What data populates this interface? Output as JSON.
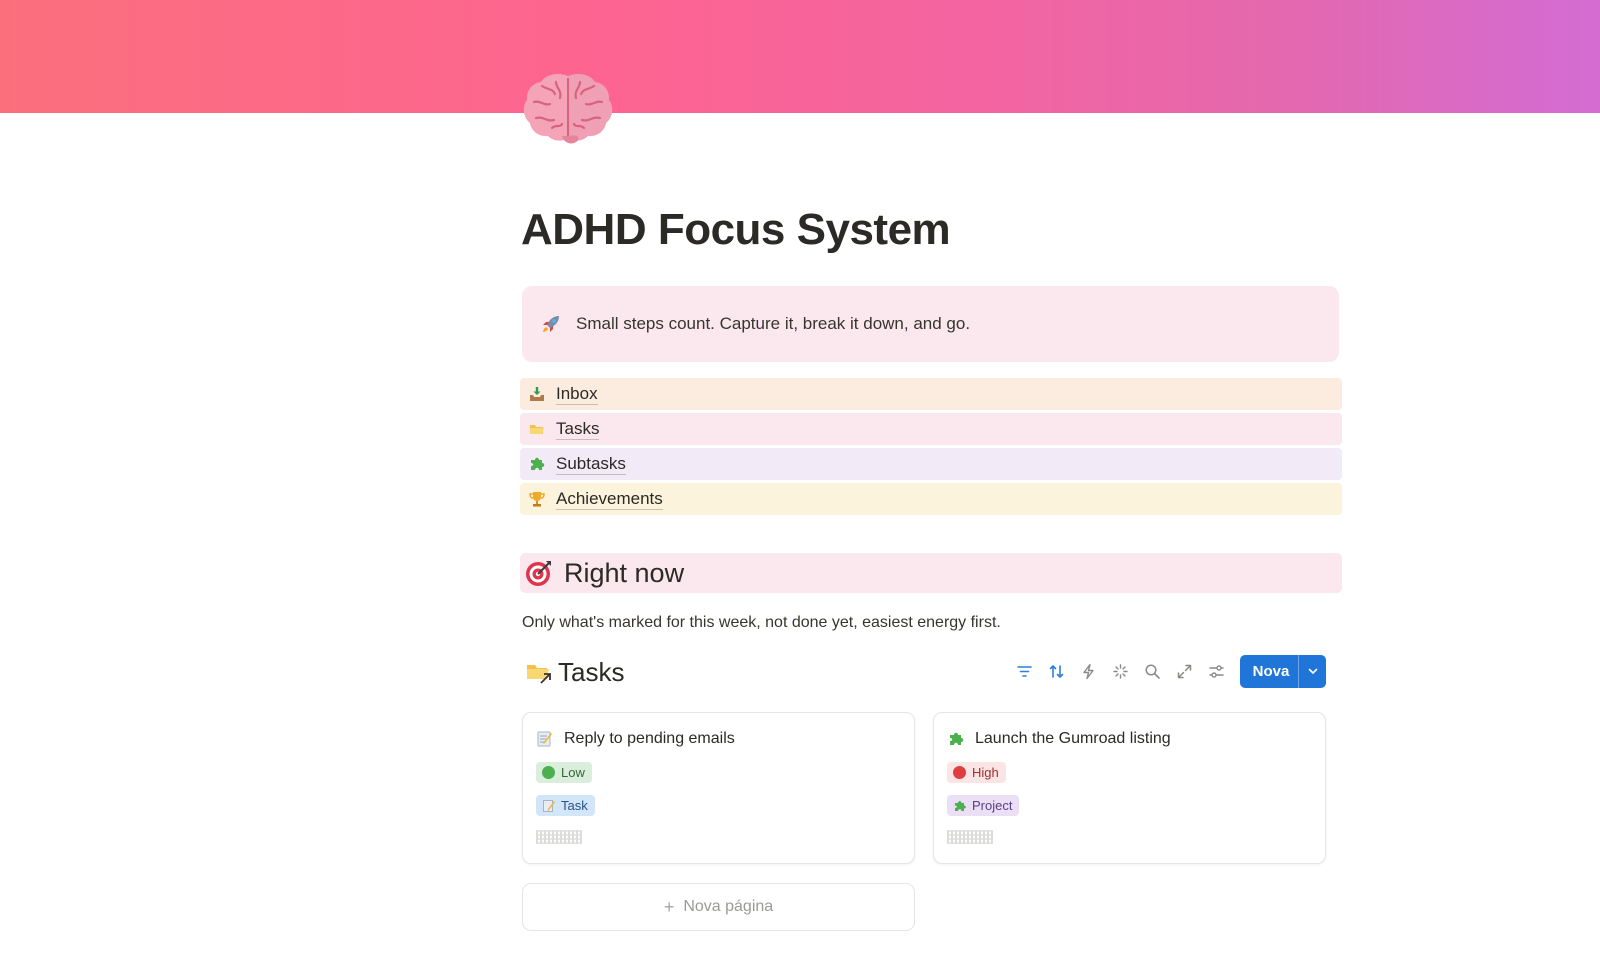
{
  "page": {
    "title": "ADHD Focus System",
    "icon": "brain-icon",
    "cover_colors": [
      "#fb6f7d",
      "#fd6491",
      "#e468ae",
      "#d36cd3"
    ]
  },
  "callout": {
    "icon": "rocket-icon",
    "text": "Small steps count. Capture it, break it down, and go.",
    "background": "#fbe8ef"
  },
  "nav": [
    {
      "label": "Inbox",
      "icon": "inbox-tray-icon",
      "background": "#fbecdf"
    },
    {
      "label": "Tasks",
      "icon": "folder-icon",
      "background": "#fbe8ef"
    },
    {
      "label": "Subtasks",
      "icon": "puzzle-piece-icon",
      "background": "#f2eaf7"
    },
    {
      "label": "Achievements",
      "icon": "trophy-icon",
      "background": "#fbf3dc"
    }
  ],
  "section": {
    "heading": "Right now",
    "heading_icon": "target-icon",
    "description": "Only what's marked for this week, not done yet, easiest energy first."
  },
  "database": {
    "title": "Tasks",
    "title_icon": "folder-link-icon",
    "tools": [
      "filter-icon",
      "sort-icon",
      "automation-bolt-icon",
      "ai-sparkle-icon",
      "search-icon",
      "expand-icon",
      "settings-sliders-icon"
    ],
    "new_button_label": "Nova",
    "new_page_label": "Nova página"
  },
  "cards": [
    {
      "title": "Reply to pending emails",
      "icon": "memo-icon",
      "priority": {
        "label": "Low",
        "color": "#4caf50",
        "background": "#dbeddb"
      },
      "type": {
        "label": "Task",
        "icon": "memo-icon",
        "background": "#d3e5f8"
      }
    },
    {
      "title": "Launch the Gumroad listing",
      "icon": "puzzle-piece-icon",
      "priority": {
        "label": "High",
        "color": "#e03e3e",
        "background": "#fbe4e4"
      },
      "type": {
        "label": "Project",
        "icon": "puzzle-piece-icon",
        "background": "#eadff5"
      }
    }
  ],
  "colors": {
    "accent": "#1f76d8",
    "tool_icon": "#2f7ed8",
    "text": "#37352f",
    "muted": "#9b9a97"
  }
}
